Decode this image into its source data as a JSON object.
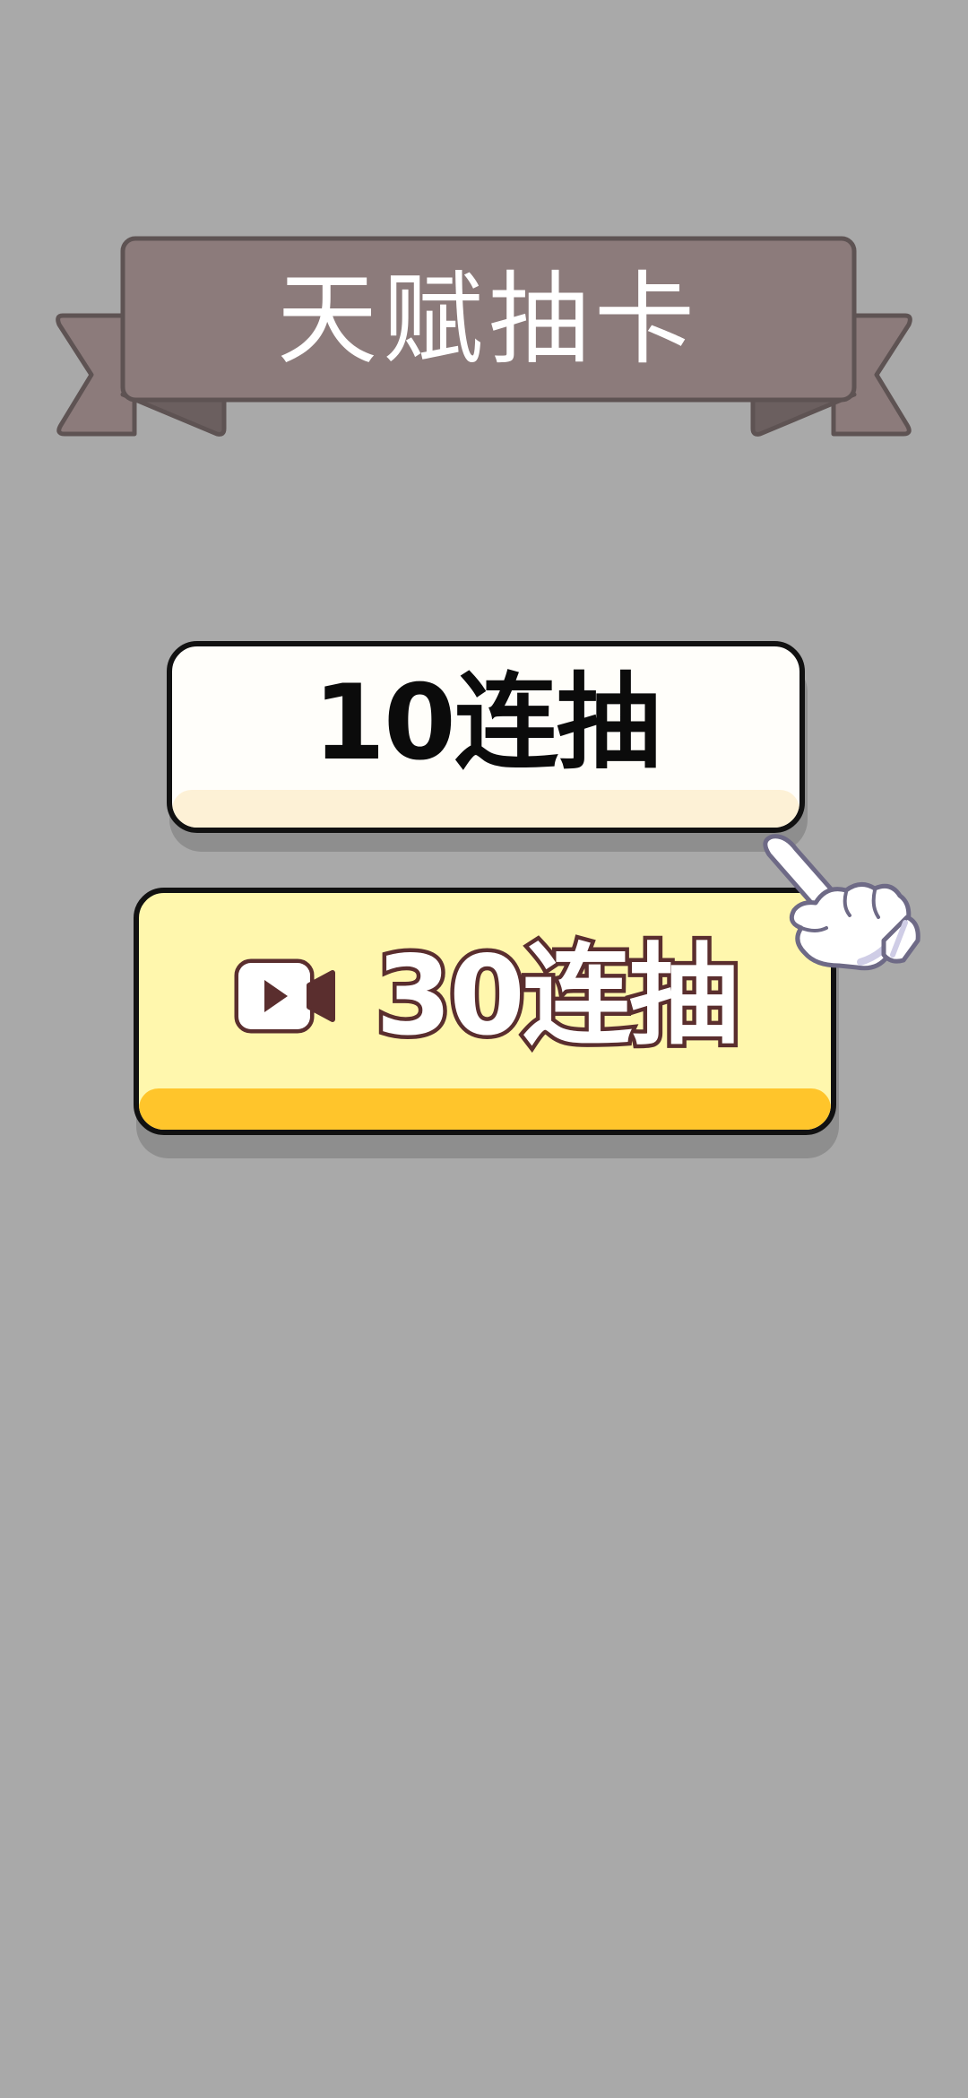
{
  "screen": {
    "background_color": "#a9a9a9"
  },
  "banner": {
    "title": "天赋抽卡",
    "ribbon_color": "#8c7b7b",
    "ribbon_shadow_color": "#6b5f5f",
    "icon": "ribbon-banner"
  },
  "buttons": {
    "draw_10": {
      "label": "10连抽",
      "background_color": "#fffefa",
      "accent_color": "#fdf1d6"
    },
    "draw_30": {
      "label": "30连抽",
      "background_color": "#fff7ad",
      "accent_color": "#ffc52b",
      "icon": "video-ad-icon",
      "text_outline_color": "#5a2e2e"
    }
  },
  "tutorial": {
    "icon": "hand-pointer-icon"
  }
}
